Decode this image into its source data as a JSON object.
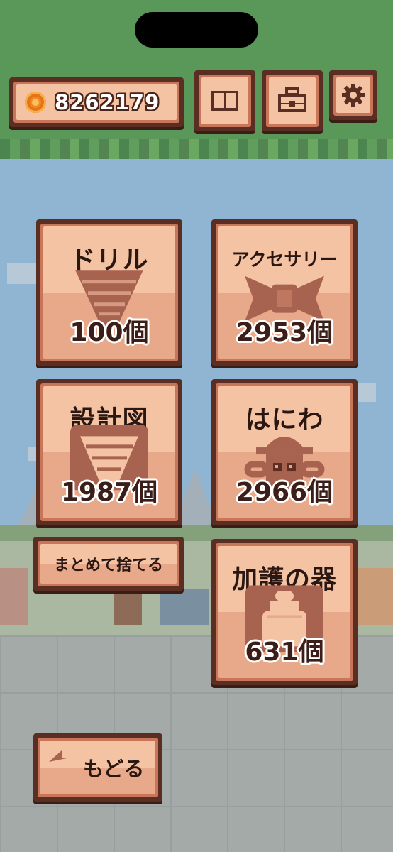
{
  "header": {
    "coins": "8262179",
    "icons": [
      "coin-icon",
      "book-icon",
      "toolbox-icon",
      "gear-icon"
    ]
  },
  "items": {
    "drill": {
      "title": "ドリル",
      "count": "100個",
      "icon": "drill-icon"
    },
    "accessory": {
      "title": "アクセサリー",
      "count": "2953個",
      "icon": "ribbon-icon"
    },
    "blueprint": {
      "title": "設計図",
      "count": "1987個",
      "icon": "blueprint-drill-icon"
    },
    "haniwa": {
      "title": "はにわ",
      "count": "2966個",
      "icon": "haniwa-icon"
    },
    "vessel": {
      "title": "加護の器",
      "count": "631個",
      "icon": "vessel-icon"
    }
  },
  "actions": {
    "discard_all": "まとめて捨てる",
    "back": "もどる"
  },
  "colors": {
    "frame": "#5a2e22",
    "card_light": "#f4c3a3",
    "card_dark": "#e8a98a",
    "icon_brown": "#a86250",
    "coin": "#f08a1e",
    "sky": "#8dc3ec",
    "grass": "#3f9a3f"
  }
}
